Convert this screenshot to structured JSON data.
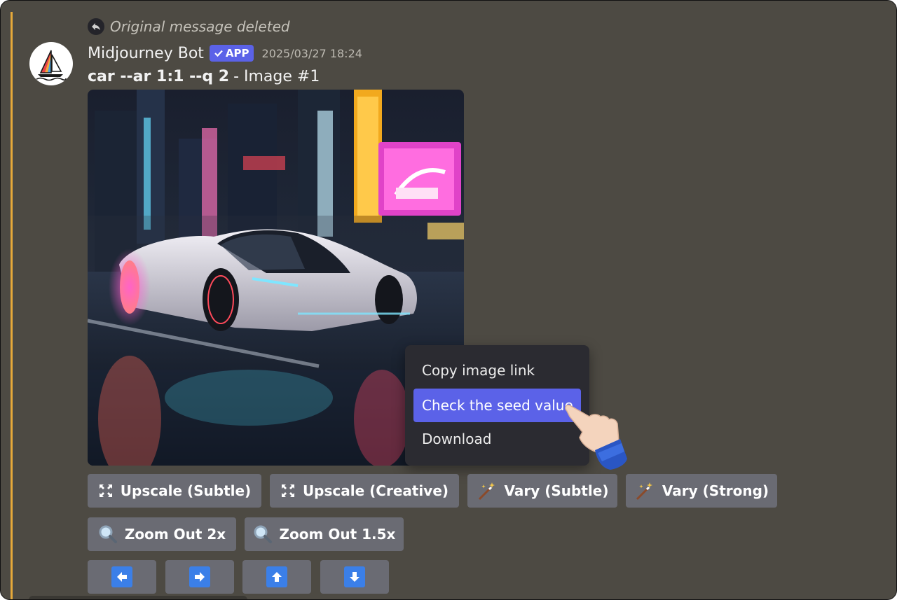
{
  "reply": {
    "text": "Original message deleted"
  },
  "message": {
    "author": "Midjourney Bot",
    "badge": "APP",
    "timestamp": "2025/03/27 18:24",
    "prompt_bold": "car --ar 1:1 --q 2",
    "prompt_rest": "- Image #1"
  },
  "context_menu": {
    "items": [
      {
        "label": "Copy image link"
      },
      {
        "label": "Check the seed value"
      },
      {
        "label": "Download"
      }
    ],
    "active_index": 1
  },
  "buttons": {
    "upscale_subtle": "Upscale (Subtle)",
    "upscale_creative": "Upscale (Creative)",
    "vary_subtle": "Vary (Subtle)",
    "vary_strong": "Vary (Strong)",
    "zoom_2x": "Zoom Out 2x",
    "zoom_15x": "Zoom Out 1.5x"
  },
  "icons": {
    "reply": "reply-arrow-icon",
    "upscale": "expand-arrows-icon",
    "vary": "magic-wand-icon",
    "zoom": "magnifier-icon",
    "pan_left": "arrow-left-icon",
    "pan_right": "arrow-right-icon",
    "pan_up": "arrow-up-icon",
    "pan_down": "arrow-down-icon"
  },
  "colors": {
    "background": "#4d4a43",
    "accent_bar": "#e6a93a",
    "badge": "#5b62e8",
    "menu_bg": "#2b2b31",
    "menu_active": "#5b62e8",
    "button_bg": "#6a6b73",
    "arrow_blue": "#3b7fe8"
  }
}
